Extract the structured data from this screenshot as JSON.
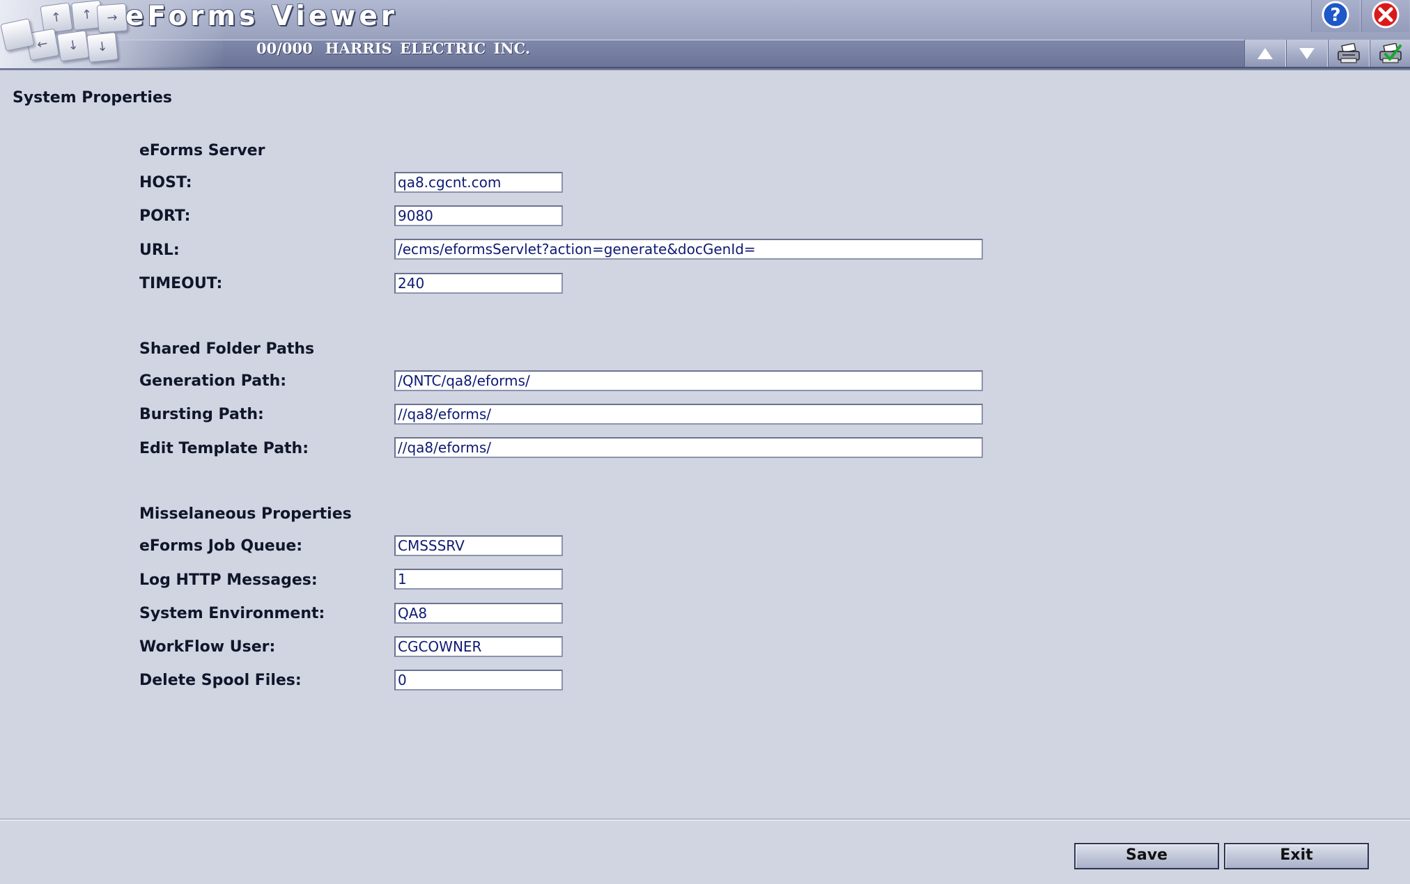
{
  "app": {
    "title": "eForms Viewer",
    "company_code": "00/000",
    "company_name": "HARRIS ELECTRIC INC."
  },
  "toolbar": {
    "help_icon": "help-icon",
    "close_icon": "close-icon",
    "up_icon": "arrow-up-icon",
    "down_icon": "arrow-down-icon",
    "print_icon": "printer-icon",
    "print_check_icon": "printer-check-icon"
  },
  "page": {
    "title": "System Properties"
  },
  "server": {
    "heading": "eForms Server",
    "host": {
      "label": "HOST:",
      "value": "qa8.cgcnt.com"
    },
    "port": {
      "label": "PORT:",
      "value": "9080"
    },
    "url": {
      "label": "URL:",
      "value": "/ecms/eformsServlet?action=generate&docGenId="
    },
    "timeout": {
      "label": "TIMEOUT:",
      "value": "240"
    }
  },
  "shared": {
    "heading": "Shared Folder Paths",
    "generation_path": {
      "label": "Generation Path:",
      "value": "/QNTC/qa8/eforms/"
    },
    "bursting_path": {
      "label": "Bursting Path:",
      "value": "//qa8/eforms/"
    },
    "edit_template_path": {
      "label": "Edit Template Path:",
      "value": "//qa8/eforms/"
    }
  },
  "misc": {
    "heading": "Misselaneous Properties",
    "job_queue": {
      "label": "eForms Job Queue:",
      "value": "CMSSSRV"
    },
    "log_http": {
      "label": "Log HTTP Messages:",
      "value": "1"
    },
    "system_env": {
      "label": "System Environment:",
      "value": "QA8"
    },
    "workflow_user": {
      "label": "WorkFlow User:",
      "value": "CGCOWNER"
    },
    "delete_spool": {
      "label": "Delete Spool Files:",
      "value": "0"
    }
  },
  "footer": {
    "save_label": "Save",
    "exit_label": "Exit"
  },
  "colors": {
    "background": "#d0d5e1",
    "header": "#a1a9c5",
    "input_text": "#0d1a73"
  }
}
